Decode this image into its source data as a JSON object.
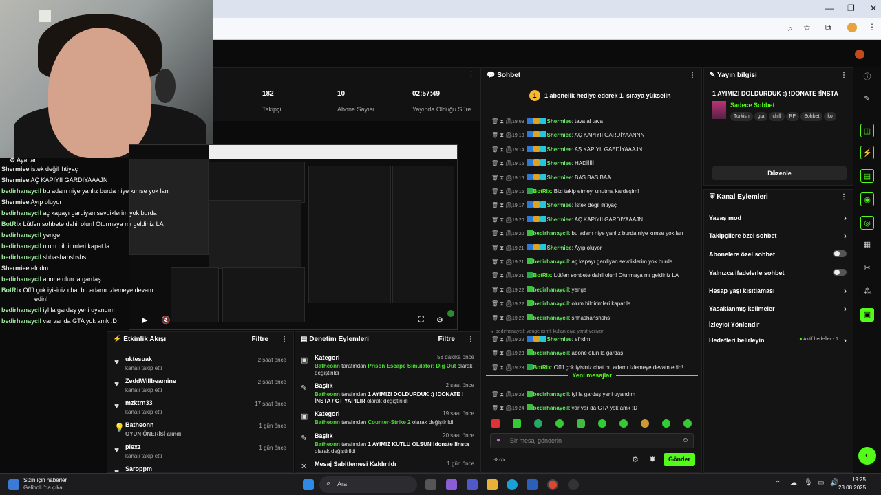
{
  "stream_stats": {
    "followers_value": "182",
    "followers_label": "Takipçi",
    "subs_value": "10",
    "subs_label": "Abone Sayısı",
    "uptime_value": "02:57:49",
    "uptime_label": "Yayında Olduğu Süre"
  },
  "overlay_chat": {
    "settings_label": "Ayarlar",
    "messages": [
      {
        "user": "Shermiee",
        "text": "istek değil ihtiyaç"
      },
      {
        "user": "Shermiee",
        "text": "AÇ KAPIYII GARDİYAAAJN"
      },
      {
        "user": "bedirhanaycil",
        "text": "bu adam niye yanlız burda niye kımse yok lan"
      },
      {
        "user": "Shermiee",
        "text": "Ayıp oluyor"
      },
      {
        "user": "bedirhanaycil",
        "text": "aç kapayı gardiyan sevdiklerim yok burda"
      },
      {
        "user": "BotRix",
        "text": "Lütfen sohbete dahil olun! Oturmaya mı geldiniz LA"
      },
      {
        "user": "bedirhanaycil",
        "text": "yenge"
      },
      {
        "user": "bedirhanaycil",
        "text": "olum bildirimleri kapat la"
      },
      {
        "user": "bedirhanaycil",
        "text": "shhashahshshs"
      },
      {
        "user": "Shermiee",
        "text": "efndm"
      },
      {
        "user": "bedirhanaycil",
        "text": "abone olun la gardaş"
      },
      {
        "user": "BotRix",
        "text": "Offff çok iyisiniz chat bu adamı izlemeye devam"
      },
      {
        "user": "",
        "text": "edin!"
      },
      {
        "user": "bedirhanaycil",
        "text": "iyl la gardaş yeni uyandım"
      },
      {
        "user": "bedirhanaycil",
        "text": "var var da GTA yok amk :D"
      }
    ]
  },
  "activity": {
    "title": "Etkinlik Akışı",
    "filter": "Filtre",
    "items": [
      {
        "name": "uktesuak",
        "sub": "kanalı takip etti",
        "time": "2 saat önce"
      },
      {
        "name": "ZeddWillbeamine",
        "sub": "kanalı takip etti",
        "time": "2 saat önce"
      },
      {
        "name": "mzktrn33",
        "sub": "kanalı takip etti",
        "time": "17 saat önce"
      },
      {
        "name": "Batheonn",
        "sub": "OYUN ÖNERİSİ alındı",
        "time": "1 gün önce"
      },
      {
        "name": "piexz",
        "sub": "kanalı takip etti",
        "time": "1 gün önce"
      },
      {
        "name": "Saroppm",
        "sub": "",
        "time": ""
      }
    ]
  },
  "moderation": {
    "title": "Denetim Eylemleri",
    "filter": "Filtre",
    "items": [
      {
        "title": "Kategori",
        "time": "58 dakika önce",
        "by": "Batheonn",
        "mid": " tarafından ",
        "value": "Prison Escape Simulator: Dig Out",
        "end": " olarak değiştirildi"
      },
      {
        "title": "Başlık",
        "time": "2 saat önce",
        "by": "Batheonn",
        "mid": " tarafından ",
        "value": "1 AYIMIZI DOLDURDUK :) !DONATE !İNSTA / GT YAPILIR",
        "end": " olarak değiştirildi"
      },
      {
        "title": "Kategori",
        "time": "19 saat önce",
        "by": "Batheonn",
        "mid": " tarafından ",
        "value": "Counter-Strike 2",
        "end": " olarak değiştirildi"
      },
      {
        "title": "Başlık",
        "time": "20 saat önce",
        "by": "Batheonn",
        "mid": " tarafından ",
        "value": "1 AYIMIZ KUTLU OLSUN !donate !insta",
        "end": " olarak değiştirildi"
      },
      {
        "title": "Mesaj Sabitlemesi Kaldırıldı",
        "time": "1 gün önce",
        "by": "",
        "mid": "",
        "value": "",
        "end": ""
      }
    ]
  },
  "chat": {
    "title": "Sohbet",
    "pinned": "1 abonelik hediye ederek 1. sıraya yükselin",
    "messages": [
      {
        "ts": "19:09",
        "user": "Shermiee",
        "text": ": tava al tava"
      },
      {
        "ts": "19:10",
        "user": "Shermiee",
        "text": ": AÇ KAPIYII GARDİYAANNN"
      },
      {
        "ts": "19:14",
        "user": "Shermiee",
        "text": ": AŞ KAPIYII GAEDİYAAAJN"
      },
      {
        "ts": "19:16",
        "user": "Shermiee",
        "text": ": HADİİİİİ"
      },
      {
        "ts": "19:16",
        "user": "Shermiee",
        "text": ": BAS BAS BAA"
      },
      {
        "ts": "19:16",
        "user": "BotRix",
        "text": ": Bizi takip etmeyi unutma kardeşim!"
      },
      {
        "ts": "19:17",
        "user": "Shermiee",
        "text": ": İstek değil ihtiyaç"
      },
      {
        "ts": "19:20",
        "user": "Shermiee",
        "text": ": AÇ KAPIYII GARDİYAAAJN"
      },
      {
        "ts": "19:20",
        "user": "bedirhanaycil",
        "text": ": bu adam niye yanlız burda niye kımse yok lan"
      },
      {
        "ts": "19:21",
        "user": "Shermiee",
        "text": ": Ayıp oluyor"
      },
      {
        "ts": "19:21",
        "user": "bedirhanaycil",
        "text": ": aç kapayı gardiyan sevdiklerim yok burda"
      },
      {
        "ts": "19:21",
        "user": "BotRix",
        "text": ": Lütfen sohbete dahil olun! Oturmaya mı geldiniz LA"
      },
      {
        "ts": "19:22",
        "user": "bedirhanaycil",
        "text": ": yenge"
      },
      {
        "ts": "19:22",
        "user": "bedirhanaycil",
        "text": ": olum bildirimleri kapat la"
      },
      {
        "ts": "19:22",
        "user": "bedirhanaycil",
        "text": ": shhashahshshs"
      }
    ],
    "reply_note": "bedirhanaycil: yenge isimli kullanıcıya yanıt veriyor",
    "messages2": [
      {
        "ts": "19:22",
        "user": "Shermiee",
        "text": ": efndm"
      },
      {
        "ts": "19:23",
        "user": "bedirhanaycil",
        "text": ": abone olun la gardaş"
      },
      {
        "ts": "19:23",
        "user": "BotRix",
        "text": ": Offff çok iyisiniz chat bu adamı izlemeye devam edin!"
      }
    ],
    "new_messages": "Yeni mesajlar",
    "messages3": [
      {
        "ts": "19:23",
        "user": "bedirhanaycil",
        "text": ": iyl la gardaş yeni uyandım"
      },
      {
        "ts": "19:24",
        "user": "bedirhanaycil",
        "text": ": var var da GTA yok amk :D"
      }
    ],
    "input_placeholder": "Bir mesaj gönderin",
    "send_label": "Gönder"
  },
  "stream_info": {
    "title": "Yayın bilgisi",
    "stream_title": "1 AYIMIZI DOLDURDUK :) !DONATE !İNSTA",
    "category": "Sadece Sohbet",
    "tags": [
      "Turkish",
      "gta",
      "chill",
      "RP",
      "Sohbet",
      "ko"
    ],
    "edit_label": "Düzenle"
  },
  "channel_actions": {
    "title": "Kanal Eylemleri",
    "items": [
      {
        "label": "Yavaş mod",
        "kind": "arrow"
      },
      {
        "label": "Takipçilere özel sohbet",
        "kind": "arrow"
      },
      {
        "label": "Abonelere özel sohbet",
        "kind": "toggle"
      },
      {
        "label": "Yalnızca ifadelerle sohbet",
        "kind": "toggle"
      },
      {
        "label": "Hesap yaşı kısıtlaması",
        "kind": "arrow"
      },
      {
        "label": "Yasaklanmış kelimeler",
        "kind": "arrow"
      },
      {
        "label": "İzleyici Yönlendir",
        "kind": "none"
      },
      {
        "label": "Hedefleri belirleyin",
        "kind": "goal",
        "extra": "Aktif hedefler - 1"
      }
    ]
  },
  "taskbar": {
    "news_title": "Sizin için haberler",
    "news_sub": "Gelibolu'da çıka...",
    "search_label": "Ara",
    "time": "19:25",
    "date": "23.08.2025"
  },
  "colors": {
    "accent": "#53fc18",
    "bg": "#0b0b0b",
    "panel": "#141414"
  }
}
